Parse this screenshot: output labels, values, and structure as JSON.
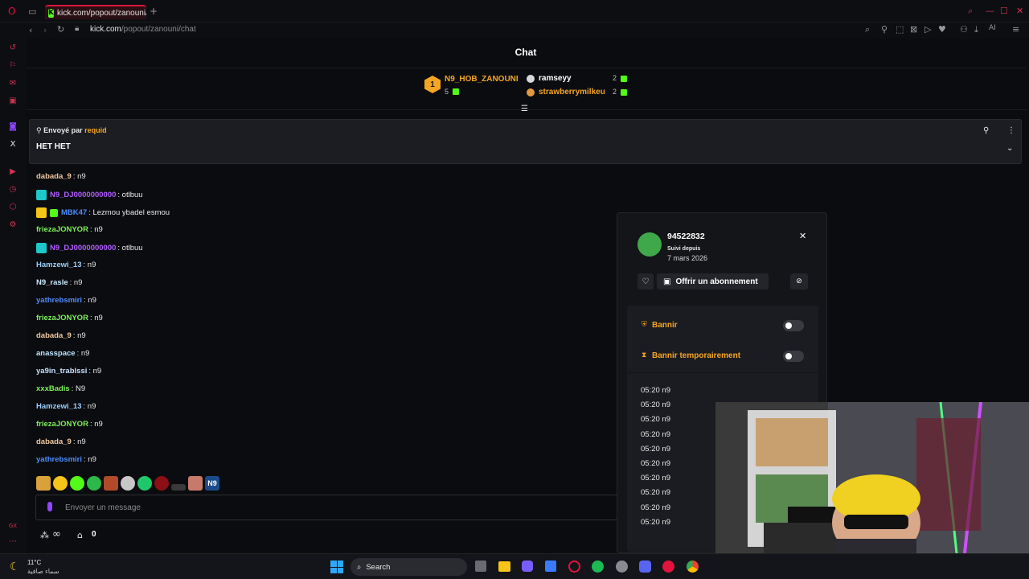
{
  "browser": {
    "tab_title": "kick.com/popout/zanouni/",
    "new_tab_label": "+",
    "url_host": "kick.com",
    "url_path": "/popout/zanouni/chat",
    "ai_label": "AI"
  },
  "chat": {
    "title": "Chat",
    "input_placeholder": "Envoyer un message",
    "points_value": "0",
    "gifters": {
      "top": {
        "rank": "1",
        "name": "N9_HOB_ZANOUNI",
        "count": "5"
      },
      "second": {
        "name": "ramseyy",
        "count": "2"
      },
      "third": {
        "name": "strawberrymilkeu",
        "count": "2"
      }
    },
    "pinned": {
      "by_label": "Envoyé par",
      "by_user": "requid",
      "message": "HET HET"
    },
    "messages": [
      {
        "user": "dabada_9",
        "text": ": n9",
        "color": "#f0c8a0"
      },
      {
        "user": "N9_DJ0000000000",
        "text": ": otlbuu",
        "color": "#b05cff",
        "badge": "#1ec8c8"
      },
      {
        "user": "MBK47",
        "text": ": Lezmou ybadel esmou",
        "color": "#4c8dff",
        "badge": "#f5c518",
        "badge2": "#53fc18"
      },
      {
        "user": "friezaJONYOR",
        "text": ": n9",
        "color": "#7cf05a"
      },
      {
        "user": "N9_DJ0000000000",
        "text": ": otlbuu",
        "color": "#b05cff",
        "badge": "#1ec8c8"
      },
      {
        "user": "Hamzewi_13",
        "text": ": n9",
        "color": "#9ad0ff"
      },
      {
        "user": "N9_rasle",
        "text": ": n9",
        "color": "#c8e8ff"
      },
      {
        "user": "yathrebsmiri",
        "text": ": n9",
        "color": "#4c8dff"
      },
      {
        "user": "friezaJONYOR",
        "text": ": n9",
        "color": "#7cf05a"
      },
      {
        "user": "dabada_9",
        "text": ": n9",
        "color": "#f0c8a0"
      },
      {
        "user": "anasspace",
        "text": ": n9",
        "color": "#bfe6ff"
      },
      {
        "user": "ya9in_trablssi",
        "text": ": n9",
        "color": "#c8e0ff"
      },
      {
        "user": "xxxBadis",
        "text": ": N9",
        "color": "#7cf05a"
      },
      {
        "user": "Hamzewi_13",
        "text": ": n9",
        "color": "#9ad0ff"
      },
      {
        "user": "friezaJONYOR",
        "text": ": n9",
        "color": "#7cf05a"
      },
      {
        "user": "dabada_9",
        "text": ": n9",
        "color": "#f0c8a0"
      },
      {
        "user": "yathrebsmiri",
        "text": ": n9",
        "color": "#4c8dff"
      }
    ],
    "emotes_n9_label": "N9"
  },
  "user_card": {
    "username": "94522832",
    "follow_label": "Suivi depuis",
    "follow_date": "7 mars 2026",
    "gift_sub_label": "Offrir un abonnement",
    "ban_label": "Bannir",
    "timeout_label": "Bannir temporairement",
    "ban_enabled": false,
    "timeout_enabled": false,
    "history": [
      "05:20 n9",
      "05:20 n9",
      "05:20 n9",
      "05:20 n9",
      "05:20 n9",
      "05:20 n9",
      "05:20 n9",
      "05:20 n9",
      "05:20 n9",
      "05:20 n9"
    ]
  },
  "taskbar": {
    "weather_temp": "11°C",
    "weather_desc": "سماء صافية",
    "search_label": "Search"
  },
  "colors": {
    "accent_orange": "#f5a524",
    "kick_green": "#53fc18",
    "opera_red": "#e0143c"
  }
}
